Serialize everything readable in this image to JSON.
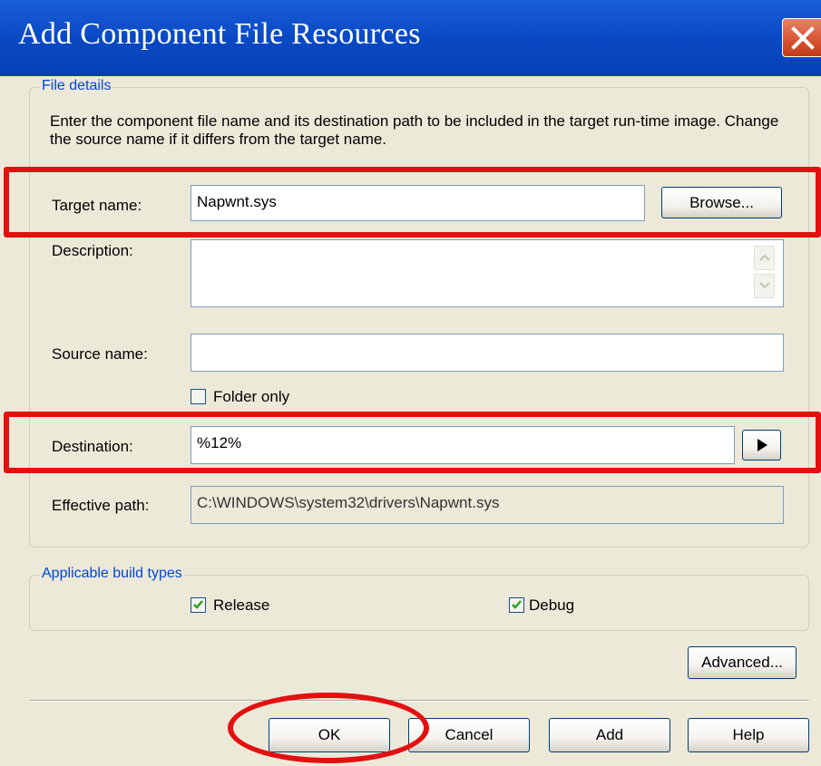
{
  "window": {
    "title": "Add Component File Resources"
  },
  "file_details": {
    "legend": "File details",
    "instructions": "Enter the component file name and its destination path to be included in the target run-time image.  Change the source name if it differs from the target name.",
    "target_name": {
      "label": "Target name:",
      "value": "Napwnt.sys"
    },
    "browse_label": "Browse...",
    "description": {
      "label": "Description:",
      "value": ""
    },
    "source_name": {
      "label": "Source name:",
      "value": ""
    },
    "folder_only": {
      "label": "Folder only",
      "checked": false
    },
    "destination": {
      "label": "Destination:",
      "value": "%12%"
    },
    "effective_path": {
      "label": "Effective path:",
      "value": "C:\\WINDOWS\\system32\\drivers\\Napwnt.sys"
    }
  },
  "build_types": {
    "legend": "Applicable build types",
    "release": {
      "label": "Release",
      "checked": true
    },
    "debug": {
      "label": "Debug",
      "checked": true
    }
  },
  "buttons": {
    "advanced": "Advanced...",
    "ok": "OK",
    "cancel": "Cancel",
    "add": "Add",
    "help": "Help"
  },
  "colors": {
    "highlight": "#e31010",
    "legend_text": "#0046d5",
    "titlebar": "#0a49c4"
  }
}
